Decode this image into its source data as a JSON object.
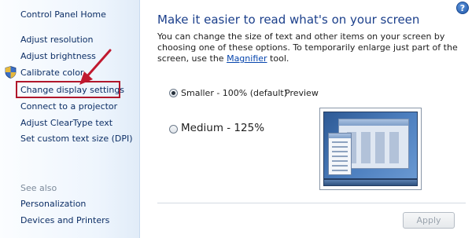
{
  "sidebar": {
    "home": "Control Panel Home",
    "links": [
      "Adjust resolution",
      "Adjust brightness",
      "Calibrate color",
      "Change display settings",
      "Connect to a projector",
      "Adjust ClearType text",
      "Set custom text size (DPI)"
    ],
    "see_also_label": "See also",
    "see_also": [
      "Personalization",
      "Devices and Printers"
    ]
  },
  "main": {
    "title": "Make it easier to read what's on your screen",
    "description_before_link": "You can change the size of text and other items on your screen by choosing one of these options. To temporarily enlarge just part of the screen, use the ",
    "description_link": "Magnifier",
    "description_after_link": " tool.",
    "options": [
      {
        "label": "Smaller - 100% (default)",
        "selected": true
      },
      {
        "label": "Medium - 125%",
        "selected": false
      }
    ],
    "preview_label": "Preview",
    "apply_label": "Apply",
    "help_glyph": "?"
  },
  "colors": {
    "link": "#0c2e65",
    "title": "#1b3f8b",
    "highlight": "#b0172b",
    "arrow": "#c0192f"
  },
  "icons": {
    "shield": "uac-shield-icon",
    "help": "help-icon"
  }
}
